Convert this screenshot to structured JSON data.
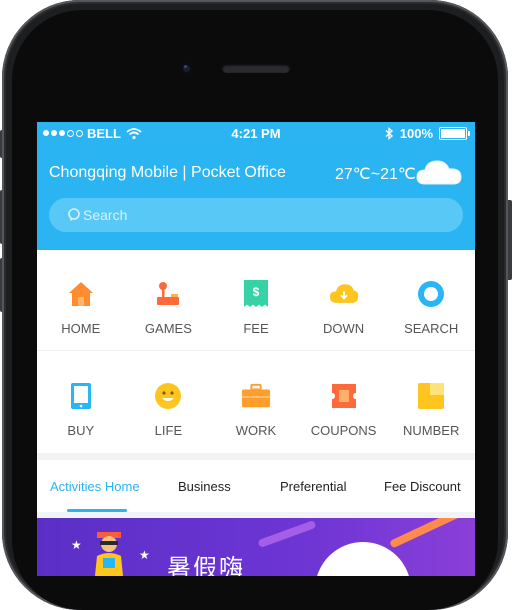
{
  "status_bar": {
    "carrier": "BELL",
    "time": "4:21 PM",
    "battery": "100%"
  },
  "header": {
    "title": "Chongqing Mobile | Pocket Office",
    "weather": "27℃~21℃",
    "weather_icon": "cloud-icon"
  },
  "search": {
    "placeholder": "Search"
  },
  "grid": {
    "row1": [
      {
        "label": "HOME",
        "icon": "home-icon",
        "color": "#ff8c2e"
      },
      {
        "label": "GAMES",
        "icon": "joystick-icon",
        "color": "#ff6a3c"
      },
      {
        "label": "FEE",
        "icon": "receipt-icon",
        "color": "#36d1a4"
      },
      {
        "label": "DOWN",
        "icon": "cloud-download-icon",
        "color": "#ffc51f"
      },
      {
        "label": "SEARCH",
        "icon": "target-icon",
        "color": "#29b6f6"
      }
    ],
    "row2": [
      {
        "label": "BUY",
        "icon": "tablet-icon",
        "color": "#29b6f6"
      },
      {
        "label": "LIFE",
        "icon": "smiley-icon",
        "color": "#ffc51f"
      },
      {
        "label": "WORK",
        "icon": "briefcase-icon",
        "color": "#ff9e2c"
      },
      {
        "label": "COUPONS",
        "icon": "coupon-icon",
        "color": "#ff6a3c"
      },
      {
        "label": "NUMBER",
        "icon": "card-icon",
        "color": "#ffc51f"
      }
    ]
  },
  "tabs": [
    {
      "label": "Activities Home",
      "active": true
    },
    {
      "label": "Business",
      "active": false
    },
    {
      "label": "Preferential",
      "active": false
    },
    {
      "label": "Fee Discount",
      "active": false
    }
  ],
  "banner": {
    "text": "暑假嗨"
  },
  "colors": {
    "accent": "#2ab4f1",
    "banner": "#5b2fc7"
  }
}
